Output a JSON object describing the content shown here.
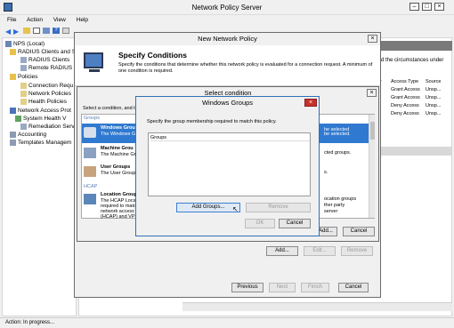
{
  "main_window": {
    "title": "Network Policy Server",
    "menu": [
      "File",
      "Action",
      "View",
      "Help"
    ],
    "tree": [
      "NPS (Local)",
      "RADIUS Clients and S",
      "RADIUS Clients",
      "Remote RADIUS S",
      "Policies",
      "Connection Requ",
      "Network Policies",
      "Health Policies",
      "Network Access Prot",
      "System Health V",
      "Remediation Serv",
      "Accounting",
      "Templates Managem"
    ],
    "right_text": "d the circumstances under",
    "columns": [
      "er",
      "Access Type",
      "Source"
    ],
    "rows": [
      [
        "",
        "Grant Access",
        "Unsp..."
      ],
      [
        "",
        "Grant Access",
        "Unsp..."
      ],
      [
        "",
        "Deny Access",
        "Unsp..."
      ],
      [
        "",
        "Deny Access",
        "Unsp..."
      ]
    ],
    "status": "Action: In progress..."
  },
  "new_policy": {
    "title": "New Network Policy",
    "heading": "Specify Conditions",
    "description": "Specify the conditions that determine whether this network policy is evaluated for a connection request. A minimum of one condition is required.",
    "add_button": "Add...",
    "edit_button": "Edit...",
    "remove_button": "Remove",
    "previous_button": "Previous",
    "next_button": "Next",
    "finish_button": "Finish",
    "cancel_button": "Cancel"
  },
  "select_condition": {
    "title": "Select condition",
    "instruction": "Select a condition, and th",
    "group_header": "Groups",
    "items": [
      {
        "title": "Windows Grou",
        "desc": "The Windows G",
        "desc2": "be selected."
      },
      {
        "title": "Machine Grou",
        "desc": "The Machine Gr",
        "desc2": ""
      },
      {
        "title": "User Groups",
        "desc": "The User Group",
        "desc2": ""
      }
    ],
    "hcap_header": "HCAP",
    "hcap_item": {
      "title": "Location Group",
      "desc": "The HCAP Locat",
      "desc2": "required to matc",
      "desc3": "network access",
      "desc4": "(HCAP) and VPN"
    },
    "right_fragments": [
      "he selected",
      "groups.",
      "cted groups.",
      "s.",
      "ocation groups",
      "ther party",
      "server"
    ],
    "add_button": "Add...",
    "cancel_button": "Cancel"
  },
  "windows_groups": {
    "title": "Windows Groups",
    "instruction": "Specify the group membership required to match this policy.",
    "list_header": "Groups",
    "add_groups_button": "Add Groups...",
    "remove_button": "Remove",
    "ok_button": "OK",
    "cancel_button": "Cancel"
  }
}
